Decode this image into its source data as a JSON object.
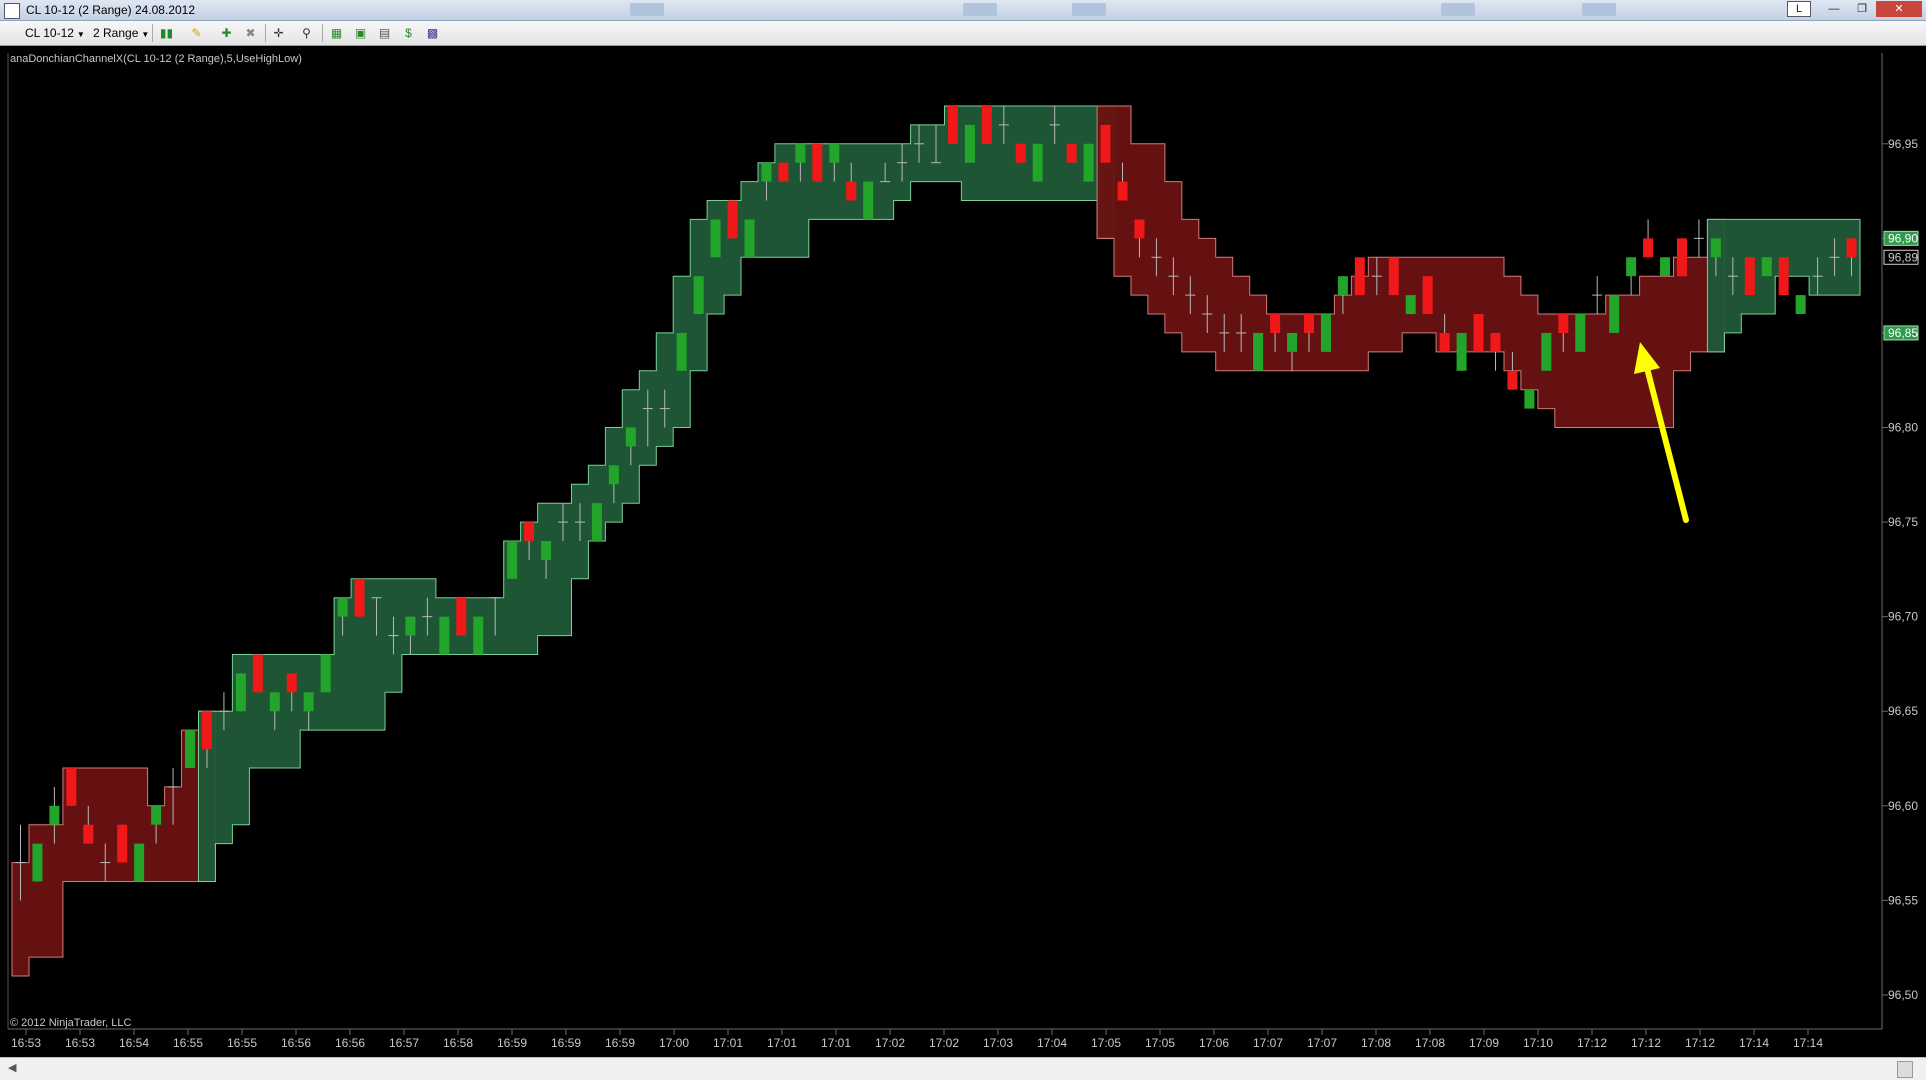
{
  "window": {
    "title": "CL 10-12 (2 Range)  24.08.2012",
    "restore_label": "L"
  },
  "toolbar": {
    "instrument": "CL 10-12",
    "period": "2 Range"
  },
  "indicator_label": "anaDonchianChannelX(CL 10-12 (2 Range),5,UseHighLow)",
  "copyright": "© 2012 NinjaTrader, LLC",
  "colors": {
    "up": "#22a52a",
    "down": "#f01818",
    "wick": "#b8b8b8",
    "channel_up": "#1f5a38",
    "channel_down": "#6b1212",
    "channel_up_edge": "#7ccf98",
    "channel_down_edge": "#d27a7a",
    "marker": "#ffff00",
    "background": "#000000"
  },
  "chart_data": {
    "type": "candlestick",
    "y_axis": {
      "ticks": [
        "96,95",
        "96,90",
        "96,85",
        "96,80",
        "96,75",
        "96,70",
        "96,65",
        "96,60",
        "96,55",
        "96,50"
      ],
      "values": [
        96.95,
        96.9,
        96.85,
        96.8,
        96.75,
        96.7,
        96.65,
        96.6,
        96.55,
        96.5
      ],
      "ylim": [
        96.482,
        96.998
      ]
    },
    "x_axis": {
      "ticks": [
        "16:53",
        "16:53",
        "16:54",
        "16:55",
        "16:55",
        "16:56",
        "16:56",
        "16:57",
        "16:58",
        "16:59",
        "16:59",
        "16:59",
        "17:00",
        "17:01",
        "17:01",
        "17:01",
        "17:02",
        "17:02",
        "17:03",
        "17:04",
        "17:05",
        "17:05",
        "17:06",
        "17:07",
        "17:07",
        "17:08",
        "17:08",
        "17:09",
        "17:10",
        "17:12",
        "17:12",
        "17:12",
        "17:14",
        "17:14"
      ]
    },
    "price_markers": [
      {
        "label": "96,90",
        "value": 96.9,
        "style": "green"
      },
      {
        "label": "96,89",
        "value": 96.89,
        "style": "outline"
      },
      {
        "label": "96,85",
        "value": 96.85,
        "style": "green"
      }
    ],
    "candles": [
      {
        "o": 96.57,
        "c": 96.57,
        "h": 96.59,
        "l": 96.55
      },
      {
        "o": 96.56,
        "c": 96.58,
        "h": 96.58,
        "l": 96.56
      },
      {
        "o": 96.59,
        "c": 96.6,
        "h": 96.61,
        "l": 96.58
      },
      {
        "o": 96.62,
        "c": 96.6,
        "h": 96.62,
        "l": 96.6
      },
      {
        "o": 96.59,
        "c": 96.58,
        "h": 96.6,
        "l": 96.58
      },
      {
        "o": 96.57,
        "c": 96.57,
        "h": 96.58,
        "l": 96.56
      },
      {
        "o": 96.59,
        "c": 96.57,
        "h": 96.59,
        "l": 96.57
      },
      {
        "o": 96.56,
        "c": 96.58,
        "h": 96.58,
        "l": 96.56
      },
      {
        "o": 96.59,
        "c": 96.6,
        "h": 96.6,
        "l": 96.58
      },
      {
        "o": 96.61,
        "c": 96.61,
        "h": 96.62,
        "l": 96.59
      },
      {
        "o": 96.62,
        "c": 96.64,
        "h": 96.64,
        "l": 96.62
      },
      {
        "o": 96.65,
        "c": 96.63,
        "h": 96.65,
        "l": 96.62
      },
      {
        "o": 96.65,
        "c": 96.65,
        "h": 96.66,
        "l": 96.64
      },
      {
        "o": 96.65,
        "c": 96.67,
        "h": 96.67,
        "l": 96.65
      },
      {
        "o": 96.68,
        "c": 96.66,
        "h": 96.68,
        "l": 96.66
      },
      {
        "o": 96.65,
        "c": 96.66,
        "h": 96.66,
        "l": 96.64
      },
      {
        "o": 96.67,
        "c": 96.66,
        "h": 96.67,
        "l": 96.65
      },
      {
        "o": 96.65,
        "c": 96.66,
        "h": 96.66,
        "l": 96.64
      },
      {
        "o": 96.66,
        "c": 96.68,
        "h": 96.68,
        "l": 96.66
      },
      {
        "o": 96.7,
        "c": 96.71,
        "h": 96.71,
        "l": 96.69
      },
      {
        "o": 96.72,
        "c": 96.7,
        "h": 96.72,
        "l": 96.7
      },
      {
        "o": 96.71,
        "c": 96.71,
        "h": 96.71,
        "l": 96.69
      },
      {
        "o": 96.69,
        "c": 96.69,
        "h": 96.7,
        "l": 96.68
      },
      {
        "o": 96.69,
        "c": 96.7,
        "h": 96.7,
        "l": 96.68
      },
      {
        "o": 96.7,
        "c": 96.7,
        "h": 96.71,
        "l": 96.69
      },
      {
        "o": 96.68,
        "c": 96.7,
        "h": 96.7,
        "l": 96.68
      },
      {
        "o": 96.71,
        "c": 96.69,
        "h": 96.71,
        "l": 96.69
      },
      {
        "o": 96.68,
        "c": 96.7,
        "h": 96.7,
        "l": 96.68
      },
      {
        "o": 96.71,
        "c": 96.71,
        "h": 96.71,
        "l": 96.69
      },
      {
        "o": 96.72,
        "c": 96.74,
        "h": 96.74,
        "l": 96.72
      },
      {
        "o": 96.75,
        "c": 96.74,
        "h": 96.75,
        "l": 96.73
      },
      {
        "o": 96.73,
        "c": 96.74,
        "h": 96.74,
        "l": 96.72
      },
      {
        "o": 96.75,
        "c": 96.75,
        "h": 96.76,
        "l": 96.74
      },
      {
        "o": 96.75,
        "c": 96.75,
        "h": 96.76,
        "l": 96.74
      },
      {
        "o": 96.74,
        "c": 96.76,
        "h": 96.76,
        "l": 96.74
      },
      {
        "o": 96.77,
        "c": 96.78,
        "h": 96.78,
        "l": 96.76
      },
      {
        "o": 96.79,
        "c": 96.8,
        "h": 96.8,
        "l": 96.78
      },
      {
        "o": 96.81,
        "c": 96.81,
        "h": 96.82,
        "l": 96.79
      },
      {
        "o": 96.81,
        "c": 96.81,
        "h": 96.82,
        "l": 96.8
      },
      {
        "o": 96.83,
        "c": 96.85,
        "h": 96.85,
        "l": 96.83
      },
      {
        "o": 96.86,
        "c": 96.88,
        "h": 96.88,
        "l": 96.86
      },
      {
        "o": 96.89,
        "c": 96.91,
        "h": 96.91,
        "l": 96.89
      },
      {
        "o": 96.92,
        "c": 96.9,
        "h": 96.92,
        "l": 96.9
      },
      {
        "o": 96.89,
        "c": 96.91,
        "h": 96.91,
        "l": 96.89
      },
      {
        "o": 96.93,
        "c": 96.94,
        "h": 96.94,
        "l": 96.92
      },
      {
        "o": 96.94,
        "c": 96.93,
        "h": 96.94,
        "l": 96.93
      },
      {
        "o": 96.94,
        "c": 96.95,
        "h": 96.95,
        "l": 96.93
      },
      {
        "o": 96.95,
        "c": 96.93,
        "h": 96.95,
        "l": 96.93
      },
      {
        "o": 96.94,
        "c": 96.95,
        "h": 96.95,
        "l": 96.93
      },
      {
        "o": 96.93,
        "c": 96.92,
        "h": 96.94,
        "l": 96.92
      },
      {
        "o": 96.91,
        "c": 96.93,
        "h": 96.93,
        "l": 96.91
      },
      {
        "o": 96.93,
        "c": 96.93,
        "h": 96.94,
        "l": 96.93
      },
      {
        "o": 96.94,
        "c": 96.94,
        "h": 96.95,
        "l": 96.93
      },
      {
        "o": 96.95,
        "c": 96.95,
        "h": 96.96,
        "l": 96.94
      },
      {
        "o": 96.94,
        "c": 96.94,
        "h": 96.96,
        "l": 96.94
      },
      {
        "o": 96.97,
        "c": 96.95,
        "h": 96.97,
        "l": 96.95
      },
      {
        "o": 96.94,
        "c": 96.96,
        "h": 96.96,
        "l": 96.94
      },
      {
        "o": 96.97,
        "c": 96.95,
        "h": 96.97,
        "l": 96.95
      },
      {
        "o": 96.96,
        "c": 96.96,
        "h": 96.97,
        "l": 96.95
      },
      {
        "o": 96.95,
        "c": 96.94,
        "h": 96.95,
        "l": 96.94
      },
      {
        "o": 96.93,
        "c": 96.95,
        "h": 96.95,
        "l": 96.93
      },
      {
        "o": 96.96,
        "c": 96.96,
        "h": 96.97,
        "l": 96.95
      },
      {
        "o": 96.95,
        "c": 96.94,
        "h": 96.95,
        "l": 96.94
      },
      {
        "o": 96.93,
        "c": 96.95,
        "h": 96.95,
        "l": 96.93
      },
      {
        "o": 96.96,
        "c": 96.94,
        "h": 96.96,
        "l": 96.94
      },
      {
        "o": 96.93,
        "c": 96.92,
        "h": 96.94,
        "l": 96.92
      },
      {
        "o": 96.91,
        "c": 96.9,
        "h": 96.91,
        "l": 96.89
      },
      {
        "o": 96.89,
        "c": 96.89,
        "h": 96.9,
        "l": 96.88
      },
      {
        "o": 96.88,
        "c": 96.88,
        "h": 96.89,
        "l": 96.87
      },
      {
        "o": 96.87,
        "c": 96.87,
        "h": 96.88,
        "l": 96.86
      },
      {
        "o": 96.86,
        "c": 96.86,
        "h": 96.87,
        "l": 96.85
      },
      {
        "o": 96.85,
        "c": 96.85,
        "h": 96.86,
        "l": 96.84
      },
      {
        "o": 96.85,
        "c": 96.85,
        "h": 96.86,
        "l": 96.84
      },
      {
        "o": 96.83,
        "c": 96.85,
        "h": 96.85,
        "l": 96.83
      },
      {
        "o": 96.86,
        "c": 96.85,
        "h": 96.86,
        "l": 96.84
      },
      {
        "o": 96.84,
        "c": 96.85,
        "h": 96.85,
        "l": 96.83
      },
      {
        "o": 96.86,
        "c": 96.85,
        "h": 96.86,
        "l": 96.84
      },
      {
        "o": 96.84,
        "c": 96.86,
        "h": 96.86,
        "l": 96.84
      },
      {
        "o": 96.87,
        "c": 96.88,
        "h": 96.88,
        "l": 96.86
      },
      {
        "o": 96.89,
        "c": 96.87,
        "h": 96.89,
        "l": 96.87
      },
      {
        "o": 96.88,
        "c": 96.88,
        "h": 96.89,
        "l": 96.87
      },
      {
        "o": 96.89,
        "c": 96.87,
        "h": 96.89,
        "l": 96.87
      },
      {
        "o": 96.86,
        "c": 96.87,
        "h": 96.87,
        "l": 96.86
      },
      {
        "o": 96.88,
        "c": 96.86,
        "h": 96.88,
        "l": 96.86
      },
      {
        "o": 96.85,
        "c": 96.84,
        "h": 96.86,
        "l": 96.84
      },
      {
        "o": 96.83,
        "c": 96.85,
        "h": 96.85,
        "l": 96.83
      },
      {
        "o": 96.86,
        "c": 96.84,
        "h": 96.86,
        "l": 96.84
      },
      {
        "o": 96.85,
        "c": 96.84,
        "h": 96.85,
        "l": 96.83
      },
      {
        "o": 96.83,
        "c": 96.82,
        "h": 96.84,
        "l": 96.82
      },
      {
        "o": 96.81,
        "c": 96.82,
        "h": 96.82,
        "l": 96.81
      },
      {
        "o": 96.83,
        "c": 96.85,
        "h": 96.85,
        "l": 96.83
      },
      {
        "o": 96.86,
        "c": 96.85,
        "h": 96.86,
        "l": 96.84
      },
      {
        "o": 96.84,
        "c": 96.86,
        "h": 96.86,
        "l": 96.84
      },
      {
        "o": 96.87,
        "c": 96.87,
        "h": 96.88,
        "l": 96.86
      },
      {
        "o": 96.85,
        "c": 96.87,
        "h": 96.87,
        "l": 96.85
      },
      {
        "o": 96.88,
        "c": 96.89,
        "h": 96.89,
        "l": 96.87
      },
      {
        "o": 96.9,
        "c": 96.89,
        "h": 96.91,
        "l": 96.89
      },
      {
        "o": 96.88,
        "c": 96.89,
        "h": 96.89,
        "l": 96.88
      },
      {
        "o": 96.9,
        "c": 96.88,
        "h": 96.9,
        "l": 96.88
      },
      {
        "o": 96.9,
        "c": 96.9,
        "h": 96.91,
        "l": 96.89
      },
      {
        "o": 96.89,
        "c": 96.9,
        "h": 96.9,
        "l": 96.88
      },
      {
        "o": 96.88,
        "c": 96.88,
        "h": 96.89,
        "l": 96.87
      },
      {
        "o": 96.89,
        "c": 96.87,
        "h": 96.89,
        "l": 96.87
      },
      {
        "o": 96.88,
        "c": 96.89,
        "h": 96.89,
        "l": 96.88
      },
      {
        "o": 96.89,
        "c": 96.87,
        "h": 96.89,
        "l": 96.87
      },
      {
        "o": 96.86,
        "c": 96.87,
        "h": 96.87,
        "l": 96.86
      },
      {
        "o": 96.88,
        "c": 96.88,
        "h": 96.89,
        "l": 96.87
      },
      {
        "o": 96.89,
        "c": 96.89,
        "h": 96.9,
        "l": 96.88
      },
      {
        "o": 96.9,
        "c": 96.89,
        "h": 96.9,
        "l": 96.88
      }
    ],
    "channel": {
      "upper": [
        96.57,
        96.59,
        96.59,
        96.62,
        96.62,
        96.62,
        96.62,
        96.62,
        96.6,
        96.61,
        96.64,
        96.65,
        96.65,
        96.68,
        96.68,
        96.68,
        96.68,
        96.68,
        96.68,
        96.71,
        96.72,
        96.72,
        96.72,
        96.72,
        96.72,
        96.71,
        96.71,
        96.71,
        96.71,
        96.74,
        96.75,
        96.76,
        96.76,
        96.77,
        96.78,
        96.8,
        96.82,
        96.83,
        96.85,
        96.88,
        96.91,
        96.92,
        96.92,
        96.93,
        96.94,
        96.95,
        96.95,
        96.95,
        96.95,
        96.95,
        96.95,
        96.95,
        96.95,
        96.96,
        96.96,
        96.97,
        96.97,
        96.97,
        96.97,
        96.97,
        96.97,
        96.97,
        96.97,
        96.97,
        96.97,
        96.97,
        96.95,
        96.95,
        96.93,
        96.91,
        96.9,
        96.89,
        96.88,
        96.87,
        96.86,
        96.86,
        96.86,
        96.86,
        96.87,
        96.88,
        96.89,
        96.89,
        96.89,
        96.89,
        96.89,
        96.89,
        96.89,
        96.89,
        96.88,
        96.87,
        96.86,
        96.86,
        96.86,
        96.86,
        96.87,
        96.87,
        96.88,
        96.88,
        96.89,
        96.89,
        96.91,
        96.91,
        96.91,
        96.91,
        96.91,
        96.91,
        96.91,
        96.91,
        96.91,
        96.91,
        96.91,
        96.91,
        96.9,
        96.9
      ],
      "lower": [
        96.51,
        96.52,
        96.52,
        96.56,
        96.56,
        96.56,
        96.56,
        96.56,
        96.56,
        96.56,
        96.56,
        96.56,
        96.58,
        96.59,
        96.62,
        96.62,
        96.62,
        96.64,
        96.64,
        96.64,
        96.64,
        96.64,
        96.66,
        96.68,
        96.68,
        96.68,
        96.68,
        96.68,
        96.68,
        96.68,
        96.68,
        96.69,
        96.69,
        96.72,
        96.74,
        96.75,
        96.76,
        96.78,
        96.79,
        96.8,
        96.83,
        96.86,
        96.87,
        96.89,
        96.89,
        96.89,
        96.89,
        96.91,
        96.91,
        96.91,
        96.91,
        96.91,
        96.92,
        96.93,
        96.93,
        96.93,
        96.92,
        96.92,
        96.92,
        96.92,
        96.92,
        96.92,
        96.92,
        96.92,
        96.9,
        96.88,
        96.87,
        96.86,
        96.85,
        96.84,
        96.84,
        96.83,
        96.83,
        96.83,
        96.83,
        96.83,
        96.83,
        96.83,
        96.83,
        96.83,
        96.84,
        96.84,
        96.85,
        96.85,
        96.84,
        96.84,
        96.84,
        96.84,
        96.83,
        96.82,
        96.81,
        96.8,
        96.8,
        96.8,
        96.8,
        96.8,
        96.8,
        96.8,
        96.83,
        96.84,
        96.84,
        96.85,
        96.86,
        96.86,
        96.88,
        96.88,
        96.87,
        96.87,
        96.87,
        96.86,
        96.86,
        96.86,
        96.85,
        96.85
      ],
      "trend": [
        -1,
        -1,
        -1,
        -1,
        -1,
        -1,
        -1,
        -1,
        -1,
        -1,
        -1,
        -1,
        1,
        1,
        1,
        1,
        1,
        1,
        1,
        1,
        1,
        1,
        1,
        1,
        1,
        1,
        1,
        1,
        1,
        1,
        1,
        1,
        1,
        1,
        1,
        1,
        1,
        1,
        1,
        1,
        1,
        1,
        1,
        1,
        1,
        1,
        1,
        1,
        1,
        1,
        1,
        1,
        1,
        1,
        1,
        1,
        1,
        1,
        1,
        1,
        1,
        1,
        1,
        1,
        1,
        -1,
        -1,
        -1,
        -1,
        -1,
        -1,
        -1,
        -1,
        -1,
        -1,
        -1,
        -1,
        -1,
        -1,
        -1,
        -1,
        -1,
        -1,
        -1,
        -1,
        -1,
        -1,
        -1,
        -1,
        -1,
        -1,
        -1,
        -1,
        -1,
        -1,
        -1,
        -1,
        -1,
        -1,
        -1,
        -1,
        1,
        1,
        1,
        1,
        1,
        1,
        1,
        1,
        1,
        1,
        1,
        1,
        1
      ]
    }
  }
}
